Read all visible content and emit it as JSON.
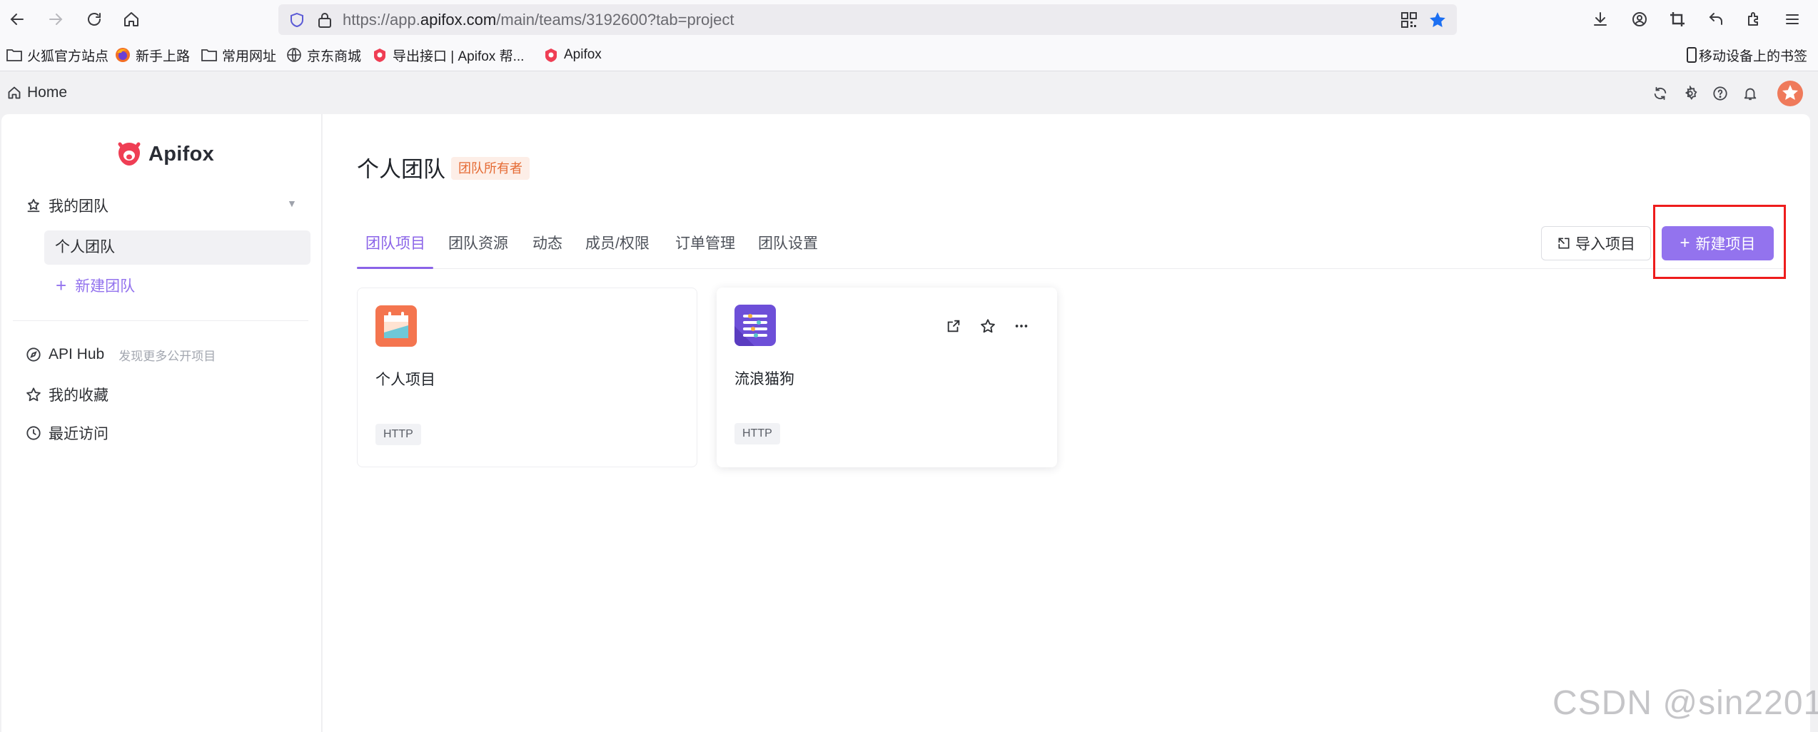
{
  "browser": {
    "url_prefix": "https://app.",
    "url_host": "apifox.com",
    "url_path": "/main/teams/3192600?tab=project"
  },
  "bookmarks": {
    "items": [
      {
        "label": "火狐官方站点",
        "icon": "folder-icon"
      },
      {
        "label": "新手上路",
        "icon": "firefox-icon"
      },
      {
        "label": "常用网址",
        "icon": "folder-icon"
      },
      {
        "label": "京东商城",
        "icon": "globe-icon"
      },
      {
        "label": "导出接口 | Apifox 帮...",
        "icon": "apifox-icon"
      },
      {
        "label": "Apifox",
        "icon": "apifox-icon"
      }
    ],
    "mobile_label": "移动设备上的书签"
  },
  "header": {
    "home_label": "Home"
  },
  "sidebar": {
    "logo_text": "Apifox",
    "my_team_label": "我的团队",
    "selected_team": "个人团队",
    "new_team_label": "新建团队",
    "api_hub_label": "API Hub",
    "api_hub_sub": "发现更多公开项目",
    "favorites_label": "我的收藏",
    "recent_label": "最近访问"
  },
  "main": {
    "team_title": "个人团队",
    "owner_badge": "团队所有者",
    "tabs": [
      {
        "label": "团队项目",
        "active": true
      },
      {
        "label": "团队资源",
        "active": false
      },
      {
        "label": "动态",
        "active": false
      },
      {
        "label": "成员/权限",
        "active": false
      },
      {
        "label": "订单管理",
        "active": false
      },
      {
        "label": "团队设置",
        "active": false
      }
    ],
    "import_label": "导入项目",
    "new_project_label": "新建项目",
    "projects": [
      {
        "name": "个人项目",
        "tag": "HTTP"
      },
      {
        "name": "流浪猫狗",
        "tag": "HTTP"
      }
    ]
  },
  "watermark": "CSDN @sin2201",
  "colors": {
    "accent": "#9373ee",
    "badge_bg": "#fdeee7",
    "badge_text": "#e56a33",
    "highlight": "#ee1c1c"
  }
}
